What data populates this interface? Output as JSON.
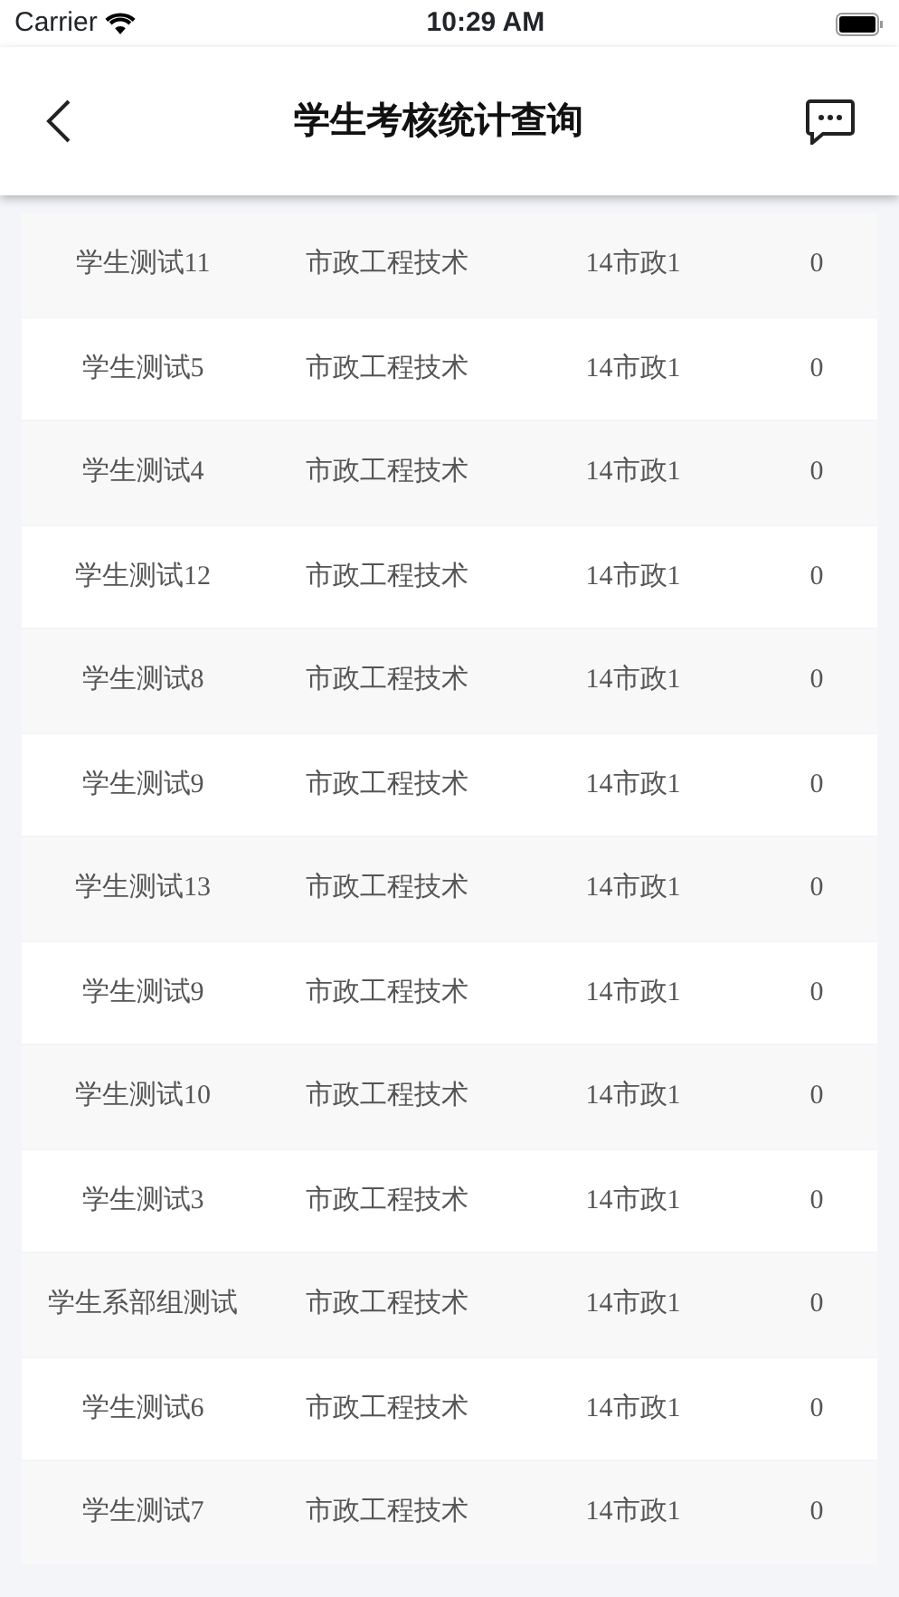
{
  "status_bar": {
    "carrier": "Carrier",
    "time": "10:29 AM"
  },
  "nav_bar": {
    "title": "学生考核统计查询"
  },
  "table": {
    "rows": [
      [
        "学生测试11",
        "市政工程技术",
        "14市政1",
        "0"
      ],
      [
        "学生测试5",
        "市政工程技术",
        "14市政1",
        "0"
      ],
      [
        "学生测试4",
        "市政工程技术",
        "14市政1",
        "0"
      ],
      [
        "学生测试12",
        "市政工程技术",
        "14市政1",
        "0"
      ],
      [
        "学生测试8",
        "市政工程技术",
        "14市政1",
        "0"
      ],
      [
        "学生测试9",
        "市政工程技术",
        "14市政1",
        "0"
      ],
      [
        "学生测试13",
        "市政工程技术",
        "14市政1",
        "0"
      ],
      [
        "学生测试9",
        "市政工程技术",
        "14市政1",
        "0"
      ],
      [
        "学生测试10",
        "市政工程技术",
        "14市政1",
        "0"
      ],
      [
        "学生测试3",
        "市政工程技术",
        "14市政1",
        "0"
      ],
      [
        "学生系部组测试",
        "市政工程技术",
        "14市政1",
        "0"
      ],
      [
        "学生测试6",
        "市政工程技术",
        "14市政1",
        "0"
      ],
      [
        "学生测试7",
        "市政工程技术",
        "14市政1",
        "0"
      ]
    ]
  }
}
